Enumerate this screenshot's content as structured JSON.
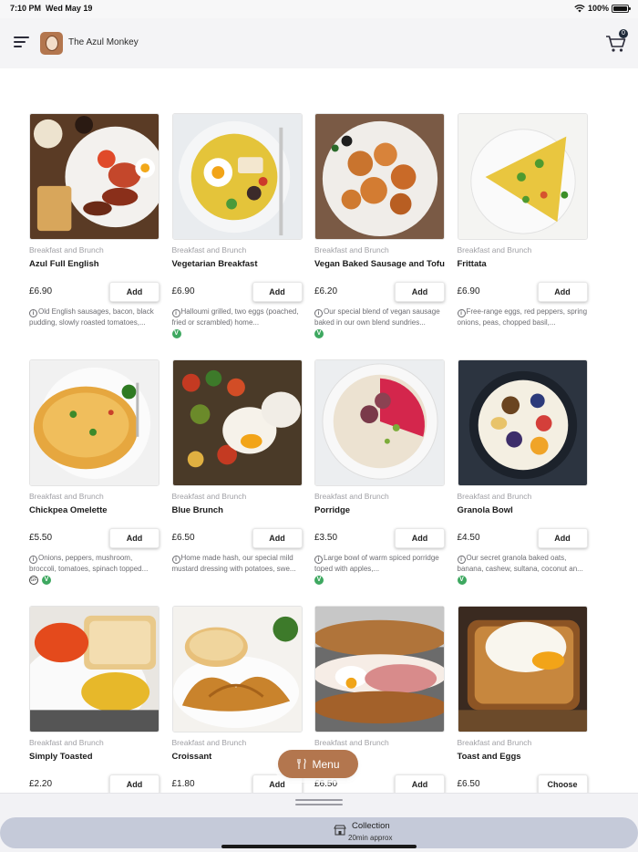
{
  "status_bar": {
    "time": "7:10 PM",
    "date": "Wed May 19",
    "battery": "100%",
    "battery_level": 1.0
  },
  "header": {
    "restaurant_name": "The Azul Monkey",
    "cart_count": "0"
  },
  "menu_items": [
    {
      "category": "Breakfast and Brunch",
      "name": "Azul Full English",
      "price": "£6.90",
      "button": "Add",
      "description": "Old English sausages, bacon, black pudding, slowly roasted tomatoes,...",
      "diet": []
    },
    {
      "category": "Breakfast and Brunch",
      "name": "Vegetarian Breakfast",
      "price": "£6.90",
      "button": "Add",
      "description": "Halloumi grilled, two eggs (poached, fried or scrambled) home...",
      "diet": [
        "V"
      ]
    },
    {
      "category": "Breakfast and Brunch",
      "name": "Vegan Baked Sausage and Tofu",
      "price": "£6.20",
      "button": "Add",
      "description": "Our special blend of vegan sausage baked in our own blend sundries...",
      "diet": [
        "V"
      ]
    },
    {
      "category": "Breakfast and Brunch",
      "name": "Frittata",
      "price": "£6.90",
      "button": "Add",
      "description": "Free-range eggs, red peppers, spring onions, peas, chopped basil,...",
      "diet": []
    },
    {
      "category": "Breakfast and Brunch",
      "name": "Chickpea Omelette",
      "price": "£5.50",
      "button": "Add",
      "description": "Onions, peppers, mushroom, broccoli, tomatoes, spinach topped...",
      "diet": [
        "GF",
        "V"
      ]
    },
    {
      "category": "Breakfast and Brunch",
      "name": "Blue Brunch",
      "price": "£6.50",
      "button": "Add",
      "description": "Home made hash, our special mild mustard dressing with potatoes, swe...",
      "diet": []
    },
    {
      "category": "Breakfast and Brunch",
      "name": "Porridge",
      "price": "£3.50",
      "button": "Add",
      "description": "Large bowl of warm spiced porridge toped with apples,...",
      "diet": [
        "V"
      ]
    },
    {
      "category": "Breakfast and Brunch",
      "name": "Granola Bowl",
      "price": "£4.50",
      "button": "Add",
      "description": "Our secret granola baked oats, banana, cashew, sultana, coconut an...",
      "diet": [
        "V"
      ]
    },
    {
      "category": "Breakfast and Brunch",
      "name": "Simply Toasted",
      "price": "£2.20",
      "button": "Add",
      "description": "",
      "diet": []
    },
    {
      "category": "Breakfast and Brunch",
      "name": "Croissant",
      "price": "£1.80",
      "button": "Add",
      "description": "",
      "diet": []
    },
    {
      "category": "Breakfast and Brunch",
      "name": "...u beurre",
      "price": "£6.50",
      "button": "Add",
      "description": "",
      "diet": []
    },
    {
      "category": "Breakfast and Brunch",
      "name": "Toast and Eggs",
      "price": "£6.50",
      "button": "Choose",
      "description": "",
      "diet": []
    }
  ],
  "floating_menu": {
    "label": "Menu"
  },
  "bottom_bar": {
    "title": "Collection",
    "subtitle": "20min approx"
  },
  "colors": {
    "accent": "#b3764e",
    "vegan_badge": "#3ea860",
    "collection_bar": "#c5cad9"
  },
  "icons": {
    "menu": "hamburger-icon",
    "cart": "cart-icon",
    "info": "info-icon",
    "menu_pill": "cutlery-icon",
    "collection": "store-icon"
  }
}
